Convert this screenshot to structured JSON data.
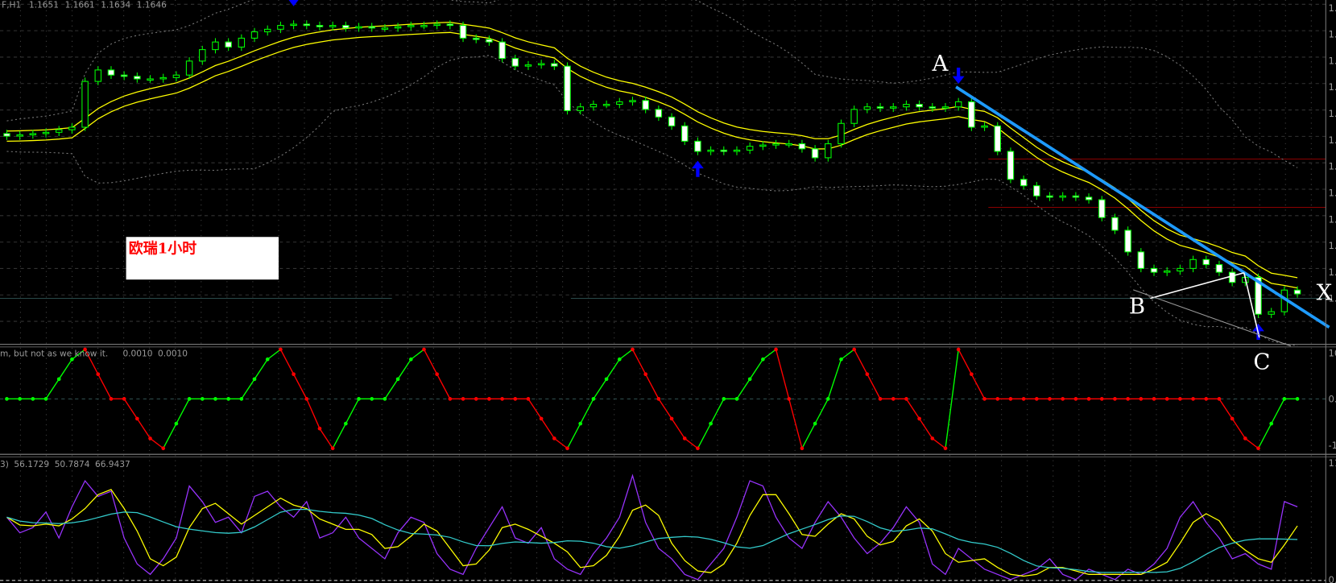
{
  "header": {
    "symbol": "F,H1",
    "open": "1.1651",
    "high": "1.1661",
    "low": "1.1634",
    "close": "1.1646"
  },
  "indicator2_label": {
    "name": "m, but not as we know it.",
    "v1": "0.0010",
    "v2": "0.0010"
  },
  "indicator3_label": {
    "name": "3)",
    "v1": "56.1729",
    "v2": "50.7874",
    "v3": "66.9437"
  },
  "chart_label": "欧瑞1小时",
  "annotations": {
    "a": "A",
    "b": "B",
    "c": "C",
    "x": "X"
  },
  "axis": {
    "main": [
      "1.",
      "1.",
      "1.",
      "1.",
      "1.",
      "1.",
      "1.",
      "1.",
      "1.",
      "1.",
      "1.",
      "1."
    ],
    "ind2": [
      "10",
      "0.0",
      "-10"
    ],
    "ind3": [
      "11",
      "0."
    ]
  },
  "colors": {
    "bg": "#000000",
    "candle": "#00ff00",
    "ma": "#ffff00",
    "trend": "#1e9bff",
    "signal": "#0000ff",
    "level": "#8b0000",
    "up": "#00ff00",
    "down": "#ff0000",
    "fast": "#9933ff",
    "mid": "#ffff00",
    "slow": "#33cccc"
  },
  "chart_data": [
    {
      "type": "candlestick",
      "title": "EURUSD H1",
      "ylim": [
        1.16,
        1.187
      ],
      "close": [
        1.1763,
        1.1764,
        1.1765,
        1.1766,
        1.1768,
        1.177,
        1.1806,
        1.1815,
        1.1811,
        1.181,
        1.1808,
        1.1808,
        1.1809,
        1.1811,
        1.1822,
        1.1831,
        1.1837,
        1.1833,
        1.184,
        1.1845,
        1.1847,
        1.185,
        1.1851,
        1.185,
        1.1849,
        1.185,
        1.1848,
        1.1849,
        1.1848,
        1.1848,
        1.1849,
        1.185,
        1.185,
        1.1851,
        1.185,
        1.184,
        1.1839,
        1.1837,
        1.1824,
        1.1818,
        1.1819,
        1.182,
        1.1818,
        1.1783,
        1.1786,
        1.1788,
        1.1788,
        1.179,
        1.1791,
        1.1784,
        1.1778,
        1.1771,
        1.1759,
        1.1751,
        1.1752,
        1.1751,
        1.1752,
        1.1755,
        1.1756,
        1.1757,
        1.1757,
        1.1753,
        1.1746,
        1.1757,
        1.1773,
        1.1784,
        1.1786,
        1.1785,
        1.1786,
        1.1788,
        1.1786,
        1.1785,
        1.1786,
        1.179,
        1.177,
        1.1771,
        1.1751,
        1.1729,
        1.1724,
        1.1716,
        1.1715,
        1.1716,
        1.1715,
        1.1713,
        1.1699,
        1.1689,
        1.1672,
        1.1659,
        1.1656,
        1.1657,
        1.1659,
        1.1666,
        1.1662,
        1.1656,
        1.1648,
        1.1652,
        1.1623,
        1.1625,
        1.1642,
        1.1639
      ],
      "signals": [
        {
          "index": 22,
          "dir": "down"
        },
        {
          "index": 53,
          "dir": "up"
        },
        {
          "index": 73,
          "dir": "down"
        },
        {
          "index": 96,
          "dir": "up"
        }
      ],
      "levels": [
        1.1745,
        1.1707
      ],
      "ma_periods": [
        10,
        20
      ]
    },
    {
      "type": "line",
      "ylim": [
        -100,
        100
      ],
      "values": [
        0,
        0,
        0,
        0,
        40,
        80,
        100,
        50,
        0,
        0,
        -40,
        -80,
        -100,
        -50,
        0,
        0,
        0,
        0,
        0,
        40,
        80,
        100,
        50,
        0,
        -60,
        -100,
        -50,
        0,
        0,
        0,
        40,
        80,
        100,
        50,
        0,
        0,
        0,
        0,
        0,
        0,
        0,
        -40,
        -80,
        -100,
        -50,
        0,
        40,
        80,
        100,
        50,
        0,
        -40,
        -80,
        -100,
        -50,
        0,
        0,
        40,
        80,
        100,
        0,
        -100,
        -50,
        0,
        80,
        100,
        50,
        0,
        0,
        0,
        -40,
        -80,
        -100,
        100,
        50,
        0,
        0,
        0,
        0,
        0,
        0,
        0,
        0,
        0,
        0,
        0,
        0,
        0,
        0,
        0,
        0,
        0,
        0,
        0,
        -40,
        -80,
        -100,
        -50,
        0,
        0
      ]
    },
    {
      "type": "line",
      "ylim": [
        0,
        110
      ],
      "fast": [
        60,
        45,
        50,
        65,
        40,
        70,
        95,
        80,
        85,
        40,
        15,
        5,
        20,
        40,
        90,
        75,
        55,
        60,
        45,
        80,
        85,
        70,
        60,
        75,
        40,
        45,
        60,
        40,
        30,
        20,
        45,
        60,
        55,
        25,
        10,
        5,
        30,
        50,
        70,
        40,
        35,
        50,
        20,
        10,
        5,
        25,
        40,
        60,
        100,
        55,
        30,
        20,
        5,
        0,
        15,
        30,
        60,
        95,
        90,
        60,
        40,
        30,
        55,
        75,
        60,
        40,
        25,
        35,
        50,
        70,
        55,
        15,
        5,
        30,
        20,
        10,
        5,
        0,
        5,
        10,
        20,
        5,
        0,
        10,
        5,
        0,
        10,
        5,
        15,
        30,
        60,
        75,
        55,
        40,
        20,
        25,
        15,
        10,
        75,
        70
      ],
      "smooth_periods": [
        3,
        8
      ]
    }
  ]
}
